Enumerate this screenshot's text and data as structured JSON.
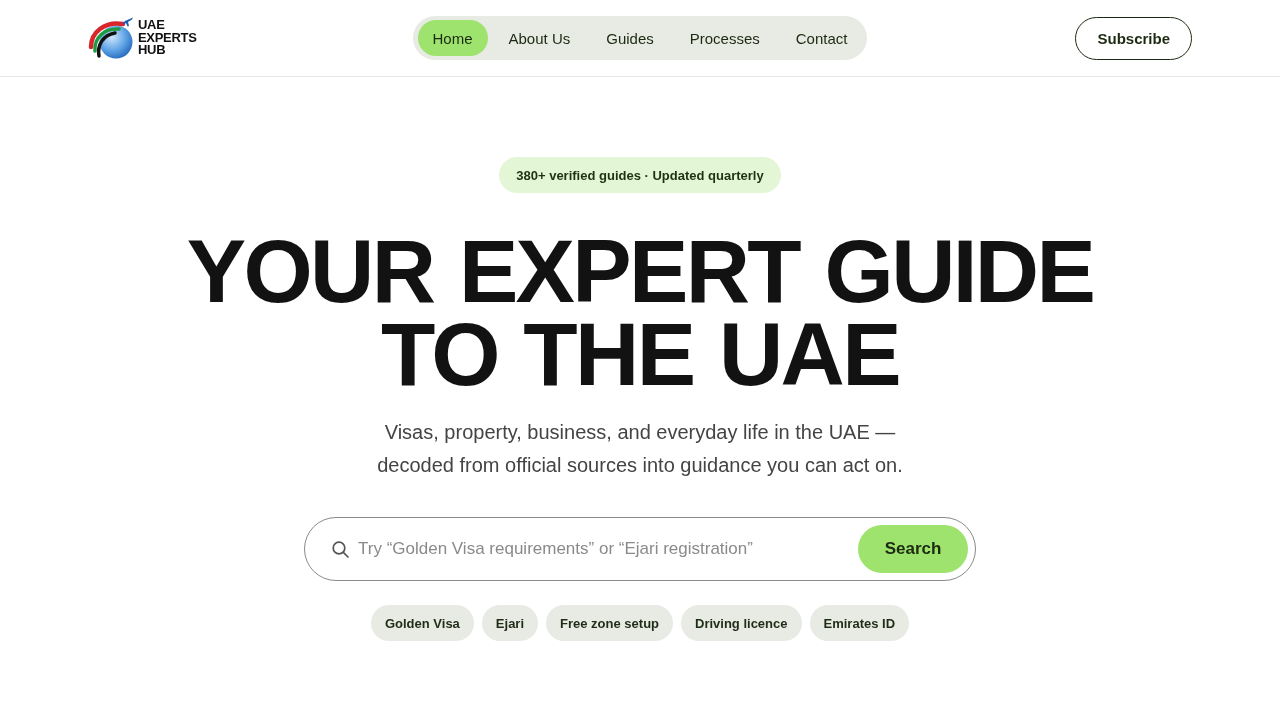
{
  "header": {
    "logo_text": "UAE EXPERTS HUB",
    "nav": [
      {
        "label": "Home",
        "selected": true
      },
      {
        "label": "About Us",
        "selected": false
      },
      {
        "label": "Guides",
        "selected": false
      },
      {
        "label": "Processes",
        "selected": false
      },
      {
        "label": "Contact",
        "selected": false
      }
    ],
    "subscribe_button": "Subscribe"
  },
  "hero": {
    "badge": "380+ verified guides · Updated quarterly",
    "headline": "YOUR EXPERT GUIDE TO THE UAE",
    "subtitle": "Visas, property, business, and everyday life in the UAE — decoded from official sources into guidance you can act on.",
    "search": {
      "placeholder": "Try “Golden Visa requirements” or “Ejari registration”",
      "button": "Search"
    },
    "chips": [
      "Golden Visa",
      "Ejari",
      "Free zone setup",
      "Driving licence",
      "Emirates ID"
    ]
  }
}
